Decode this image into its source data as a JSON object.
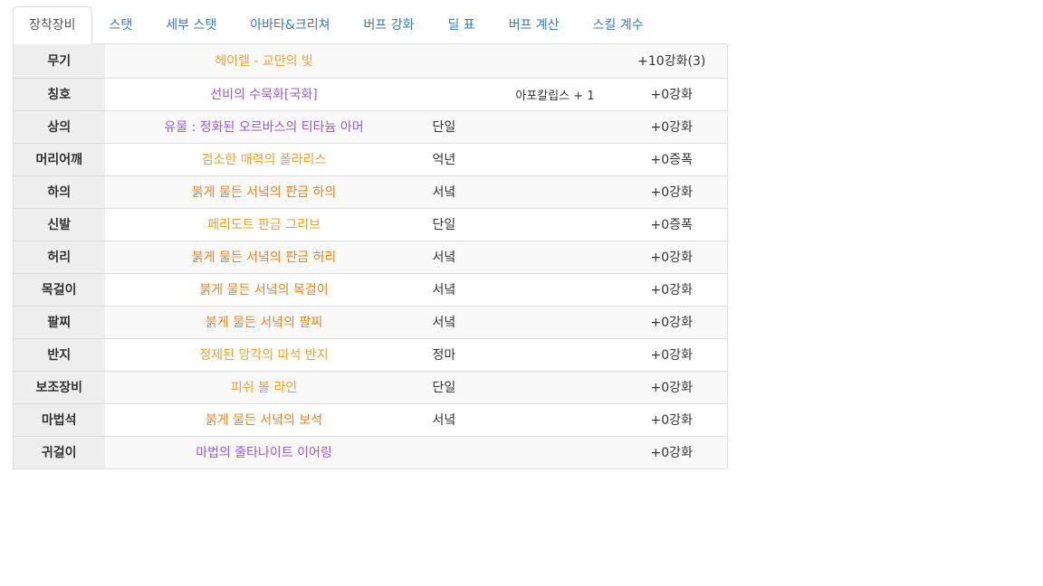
{
  "tabs": [
    {
      "label": "장착장비",
      "active": true
    },
    {
      "label": "스탯",
      "active": false
    },
    {
      "label": "세부 스탯",
      "active": false
    },
    {
      "label": "아바타&크리쳐",
      "active": false
    },
    {
      "label": "버프 강화",
      "active": false
    },
    {
      "label": "딜 표",
      "active": false
    },
    {
      "label": "버프 계산",
      "active": false
    },
    {
      "label": "스킬 계수",
      "active": false
    }
  ],
  "colors": {
    "epic": "#f0a030",
    "unique": "#9b59d0",
    "set": "#e8821e",
    "amplify": "#c020c0",
    "tab_link": "#337ab7"
  },
  "equipment": [
    {
      "slot": "무기",
      "item": "헤이렐 - 교만의 빛",
      "rarity": "epic",
      "set": "",
      "option": "",
      "enhance": "+10강화(3)",
      "enhance_type": "normal"
    },
    {
      "slot": "칭호",
      "item": "선비의 수묵화[국화]",
      "rarity": "unique",
      "set": "",
      "option": "아포칼립스 + 1",
      "enhance": "+0강화",
      "enhance_type": "normal"
    },
    {
      "slot": "상의",
      "item": "유물 : 정화된 오르바스의 티타늄 아머",
      "rarity": "unique",
      "set": "단일",
      "option": "",
      "enhance": "+0강화",
      "enhance_type": "normal"
    },
    {
      "slot": "머리어깨",
      "item": "검소한 매력의 폴라리스",
      "rarity": "epic",
      "set": "억년",
      "option": "",
      "enhance": "+0증폭",
      "enhance_type": "amplify"
    },
    {
      "slot": "하의",
      "item": "붉게 물든 서녘의 판금 하의",
      "rarity": "set",
      "set": "서녘",
      "option": "",
      "enhance": "+0강화",
      "enhance_type": "normal"
    },
    {
      "slot": "신발",
      "item": "페리도트 판금 그리브",
      "rarity": "epic",
      "set": "단일",
      "option": "",
      "enhance": "+0증폭",
      "enhance_type": "amplify"
    },
    {
      "slot": "허리",
      "item": "붉게 물든 서녘의 판금 허리",
      "rarity": "set",
      "set": "서녘",
      "option": "",
      "enhance": "+0강화",
      "enhance_type": "normal"
    },
    {
      "slot": "목걸이",
      "item": "붉게 물든 서녘의 목걸이",
      "rarity": "set",
      "set": "서녘",
      "option": "",
      "enhance": "+0강화",
      "enhance_type": "normal"
    },
    {
      "slot": "팔찌",
      "item": "붉게 물든 서녘의 팔찌",
      "rarity": "set",
      "set": "서녘",
      "option": "",
      "enhance": "+0강화",
      "enhance_type": "normal"
    },
    {
      "slot": "반지",
      "item": "정제된 망각의 마석 반지",
      "rarity": "epic",
      "set": "정마",
      "option": "",
      "enhance": "+0강화",
      "enhance_type": "normal"
    },
    {
      "slot": "보조장비",
      "item": "피쉬 볼 라인",
      "rarity": "epic",
      "set": "단일",
      "option": "",
      "enhance": "+0강화",
      "enhance_type": "normal"
    },
    {
      "slot": "마법석",
      "item": "붉게 물든 서녘의 보석",
      "rarity": "set",
      "set": "서녘",
      "option": "",
      "enhance": "+0강화",
      "enhance_type": "normal"
    },
    {
      "slot": "귀걸이",
      "item": "마법의 줄타나이트 이어링",
      "rarity": "unique",
      "set": "",
      "option": "",
      "enhance": "+0강화",
      "enhance_type": "normal"
    }
  ]
}
